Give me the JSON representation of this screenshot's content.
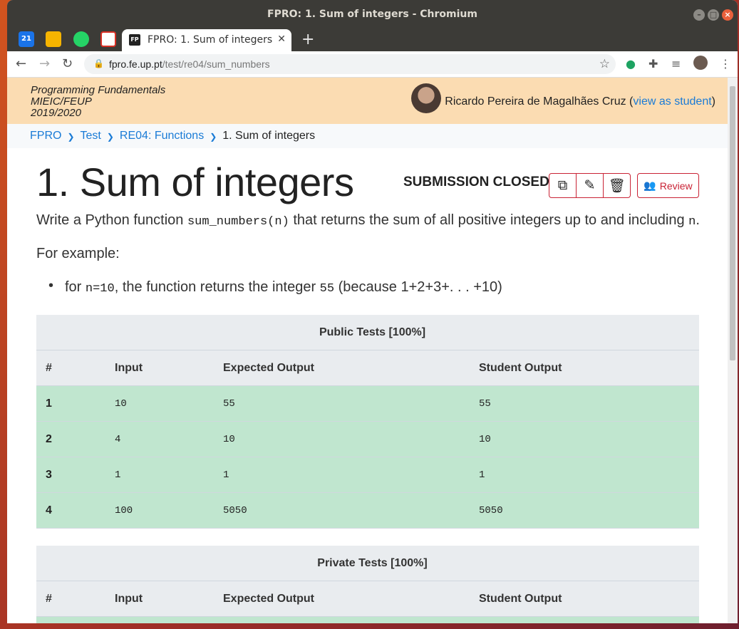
{
  "window": {
    "title": "FPRO: 1. Sum of integers - Chromium"
  },
  "tabs": {
    "pinned": [
      {
        "name": "calendar-tab-icon",
        "label": "21"
      },
      {
        "name": "keep-tab-icon",
        "label": ""
      },
      {
        "name": "whatsapp-tab-icon",
        "label": ""
      },
      {
        "name": "gmail-tab-icon",
        "label": ""
      }
    ],
    "active_label": "FPRO: 1. Sum of integers",
    "active_favicon": "FP"
  },
  "addressbar": {
    "host": "fpro.fe.up.pt",
    "path": "/test/re04/sum_numbers"
  },
  "header": {
    "course_line1": "Programming Fundamentals",
    "course_line2": "MIEIC/FEUP",
    "course_line3": "2019/2020",
    "user_name": "Ricardo Pereira de Magalhães Cruz (",
    "view_as_student": "view as student",
    "user_suffix": ")"
  },
  "breadcrumb": [
    "FPRO",
    "Test",
    "RE04: Functions",
    "1. Sum of integers"
  ],
  "main": {
    "title": "1. Sum of integers",
    "status": "SUBMISSION CLOSED",
    "review_label": "Review",
    "desc_pre": "Write a Python function ",
    "desc_code": "sum_numbers(n)",
    "desc_mid": " that returns the sum of all positive integers up to and including ",
    "desc_code2": "n",
    "desc_post": ".",
    "example_label": "For example:",
    "bullet_pre": "for ",
    "bullet_code": "n=10",
    "bullet_mid": ", the function returns the integer ",
    "bullet_code2": "55",
    "bullet_post": " (because 1+2+3+. . . +10)"
  },
  "public_tests": {
    "title": "Public Tests [100%]",
    "columns": [
      "#",
      "Input",
      "Expected Output",
      "Student Output"
    ],
    "rows": [
      [
        "1",
        "10",
        "55",
        "55"
      ],
      [
        "2",
        "4",
        "10",
        "10"
      ],
      [
        "3",
        "1",
        "1",
        "1"
      ],
      [
        "4",
        "100",
        "5050",
        "5050"
      ]
    ]
  },
  "private_tests": {
    "title": "Private Tests [100%]",
    "columns": [
      "#",
      "Input",
      "Expected Output",
      "Student Output"
    ]
  },
  "colors": {
    "accent": "#1a7bd6",
    "danger": "#c92335",
    "pass": "#c0e6cf",
    "header": "#fbdcb2"
  }
}
